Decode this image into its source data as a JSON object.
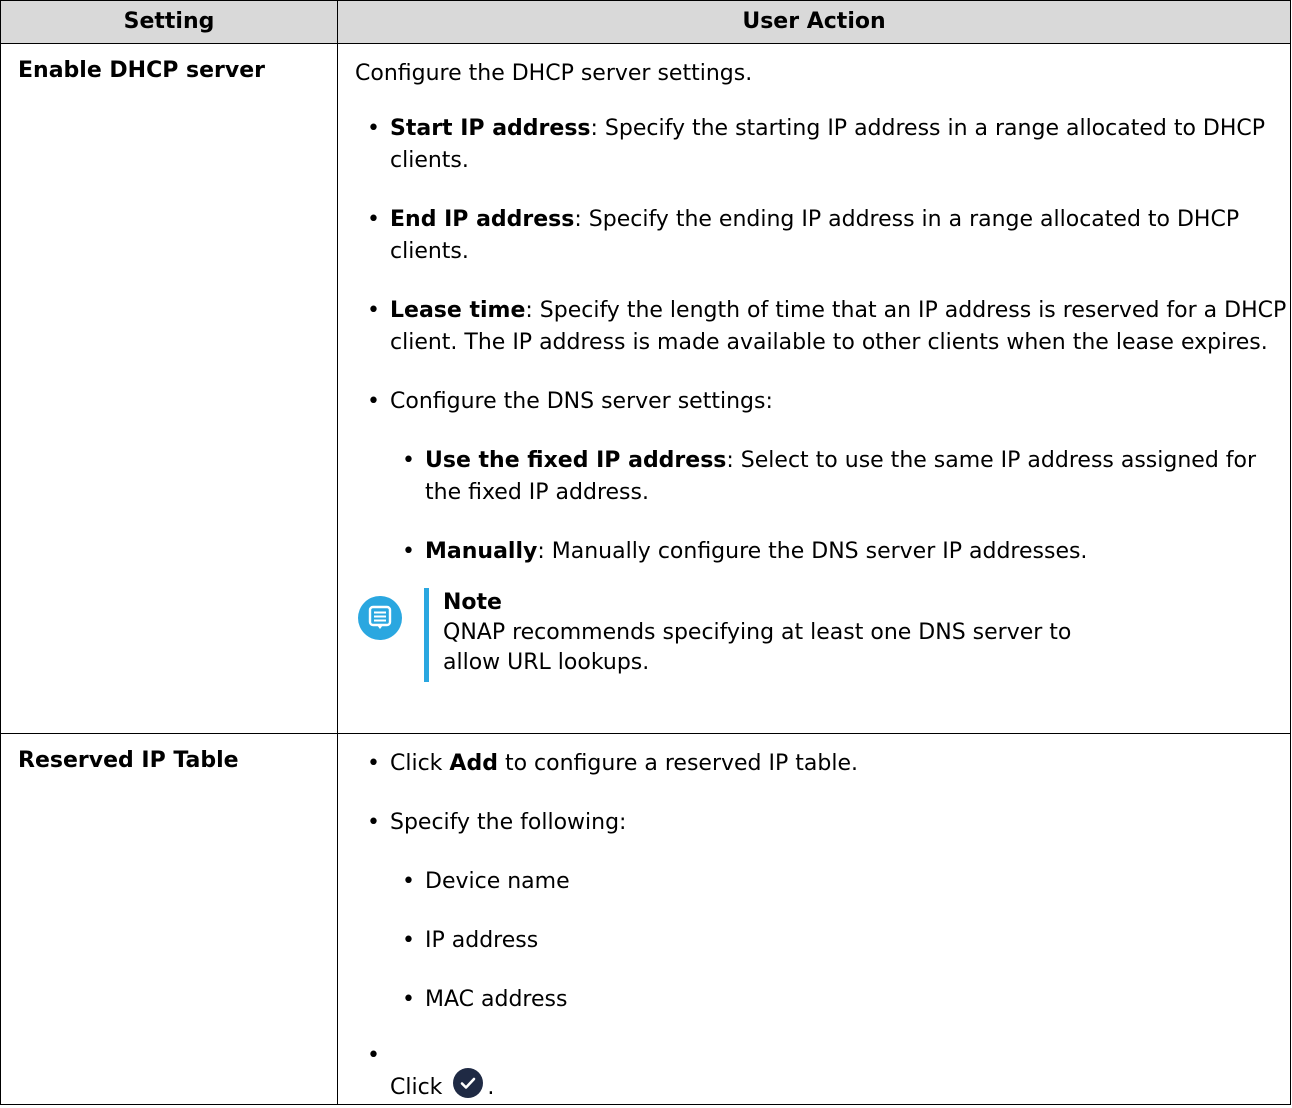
{
  "header": {
    "col1": "Setting",
    "col2": "User Action"
  },
  "rows": [
    {
      "setting": "Enable DHCP server",
      "intro": "Configure the DHCP server settings.",
      "items": [
        {
          "bold": "Start IP address",
          "text": ": Specify the starting IP address in a range allocated to DHCP clients."
        },
        {
          "bold": "End IP address",
          "text": ": Specify the ending IP address in a range allocated to DHCP clients."
        },
        {
          "bold": "Lease time",
          "text": ": Specify the length of time that an IP address is reserved for a DHCP client. The IP address is made available to other clients when the lease expires."
        },
        {
          "text": "Configure the DNS server settings:"
        }
      ],
      "subitems": [
        {
          "bold": "Use the fixed IP address",
          "text": ": Select to use the same IP address assigned for the fixed IP address."
        },
        {
          "bold": "Manually",
          "text": ": Manually configure the DNS server IP addresses."
        }
      ],
      "note": {
        "title": "Note",
        "body": "QNAP recommends specifying at least one DNS server to allow URL lookups."
      }
    },
    {
      "setting": "Reserved IP Table",
      "items": [
        {
          "pre": "Click ",
          "bold": "Add",
          "text": " to configure a reserved IP table."
        },
        {
          "text": "Specify the following:"
        }
      ],
      "subitems": [
        {
          "text": "Device name"
        },
        {
          "text": "IP address"
        },
        {
          "text": "MAC address"
        }
      ],
      "last": {
        "pre": "Click ",
        "post": "."
      }
    }
  ],
  "bullet": "•",
  "colors": {
    "header_bg": "#d9d9d9",
    "note_accent": "#2aa7e0",
    "check_icon": "#1f2a44"
  }
}
